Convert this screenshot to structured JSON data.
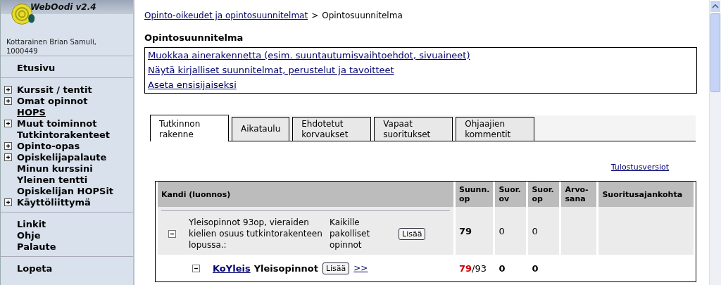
{
  "app": {
    "title": "WebOodi v2.4",
    "user": "Kottarainen Brian Samuli, 1000449"
  },
  "menu_groups": [
    {
      "items": [
        {
          "label": "Etusivu",
          "expandable": false,
          "selected": false
        }
      ]
    },
    {
      "items": [
        {
          "label": "Kurssit / tentit",
          "expandable": true,
          "selected": false
        },
        {
          "label": "Omat opinnot",
          "expandable": true,
          "selected": false
        },
        {
          "label": "HOPS",
          "expandable": false,
          "selected": true
        },
        {
          "label": "Muut toiminnot",
          "expandable": true,
          "selected": false
        },
        {
          "label": "Tutkintorakenteet",
          "expandable": false,
          "selected": false
        },
        {
          "label": "Opinto-opas",
          "expandable": true,
          "selected": false
        },
        {
          "label": "Opiskelijapalaute",
          "expandable": true,
          "selected": false
        },
        {
          "label": "Minun kurssini",
          "expandable": false,
          "selected": false
        },
        {
          "label": "Yleinen tentti",
          "expandable": false,
          "selected": false
        },
        {
          "label": "Opiskelijan HOPSit",
          "expandable": false,
          "selected": false
        },
        {
          "label": "Käyttöliittymä",
          "expandable": true,
          "selected": false
        }
      ]
    },
    {
      "items": [
        {
          "label": "Linkit",
          "expandable": false,
          "selected": false
        },
        {
          "label": "Ohje",
          "expandable": false,
          "selected": false
        },
        {
          "label": "Palaute",
          "expandable": false,
          "selected": false
        }
      ]
    },
    {
      "items": [
        {
          "label": "Lopeta",
          "expandable": false,
          "selected": false
        }
      ]
    }
  ],
  "breadcrumb": {
    "link": "Opinto-oikeudet ja opintosuunnitelmat",
    "separator": ">",
    "current": "Opintosuunnitelma"
  },
  "heading": "Opintosuunnitelma",
  "actions": [
    "Muokkaa ainerakennetta (esim. suuntautumisvaihtoehdot, sivuaineet)",
    "Näytä kirjalliset suunnitelmat, perustelut ja tavoitteet",
    "Aseta ensisijaiseksi"
  ],
  "tabs": [
    {
      "label": "Tutkinnon rakenne",
      "selected": true
    },
    {
      "label": "Aikataulu",
      "selected": false
    },
    {
      "label": "Ehdotetut korvaukset",
      "selected": false
    },
    {
      "label": "Vapaat suoritukset",
      "selected": false
    },
    {
      "label": "Ohjaajien kommentit",
      "selected": false
    }
  ],
  "print_link": "Tulostusversiot",
  "table": {
    "columns": [
      "Kandi (luonnos)",
      "Suunn. op",
      "Suor. ov",
      "Suor. op",
      "Arvo-sana",
      "Suoritusajankohta"
    ],
    "rows": [
      {
        "kind": "group",
        "expanded": true,
        "name": "Yleisopinnot 93op, vieraiden kielien osuus tutkintorakenteen lopussa.:",
        "note": "Kaikille pakolliset opinnot",
        "button": "Lisää",
        "planned": [
          {
            "text": "79",
            "color": "#000000"
          }
        ],
        "done_ov": "0",
        "done_op": "0"
      },
      {
        "kind": "module",
        "expanded": true,
        "code": "KoYleis",
        "name": "Yleisopinnot",
        "button": "Lisää",
        "more": ">>",
        "planned": [
          {
            "text": "79",
            "color": "#cc0000"
          },
          {
            "text": "/93",
            "color": "#000000"
          }
        ],
        "done_ov": "0",
        "done_op": "0"
      }
    ]
  }
}
